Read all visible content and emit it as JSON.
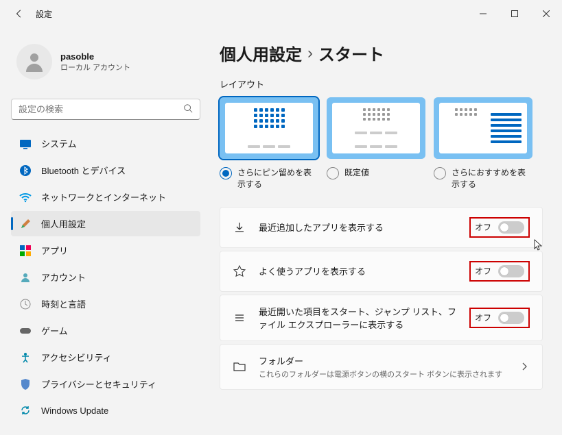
{
  "titlebar": {
    "title": "設定"
  },
  "profile": {
    "name": "pasoble",
    "sub": "ローカル アカウント"
  },
  "search": {
    "placeholder": "設定の検索"
  },
  "nav": {
    "items": [
      {
        "label": "システム"
      },
      {
        "label": "Bluetooth とデバイス"
      },
      {
        "label": "ネットワークとインターネット"
      },
      {
        "label": "個人用設定"
      },
      {
        "label": "アプリ"
      },
      {
        "label": "アカウント"
      },
      {
        "label": "時刻と言語"
      },
      {
        "label": "ゲーム"
      },
      {
        "label": "アクセシビリティ"
      },
      {
        "label": "プライバシーとセキュリティ"
      },
      {
        "label": "Windows Update"
      }
    ]
  },
  "breadcrumb": {
    "parent": "個人用設定",
    "sep": "›",
    "current": "スタート"
  },
  "section": {
    "layout": "レイアウト"
  },
  "layout_options": {
    "more_pins": "さらにピン留めを表示する",
    "default": "既定値",
    "more_recs": "さらにおすすめを表示する"
  },
  "settings": {
    "recent_apps": {
      "title": "最近追加したアプリを表示する",
      "state": "オフ"
    },
    "most_used": {
      "title": "よく使うアプリを表示する",
      "state": "オフ"
    },
    "recent_items": {
      "title": "最近開いた項目をスタート、ジャンプ リスト、ファイル エクスプローラーに表示する",
      "state": "オフ"
    },
    "folders": {
      "title": "フォルダー",
      "sub": "これらのフォルダーは電源ボタンの横のスタート ボタンに表示されます"
    }
  }
}
